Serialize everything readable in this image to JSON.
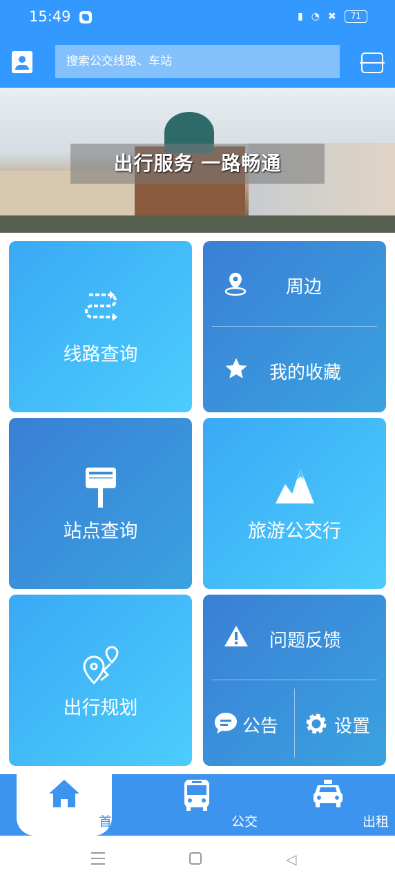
{
  "status_bar": {
    "time": "15:49",
    "battery": "71"
  },
  "header": {
    "search_placeholder": "搜索公交线路、车站"
  },
  "banner": {
    "caption": "出行服务 一路畅通"
  },
  "tiles": {
    "route_query": "线路查询",
    "nearby": "周边",
    "favorites": "我的收藏",
    "station_query": "站点查询",
    "tourism_bus": "旅游公交行",
    "trip_planning": "出行规划",
    "feedback": "问题反馈",
    "notice": "公告",
    "settings": "设置"
  },
  "colors": {
    "primary": "#3399ff",
    "nav": "#3d94ee",
    "tile_light": "#45bdf9",
    "tile_dark": "#3a8fdb"
  },
  "bottom_nav": [
    {
      "label": "首页",
      "icon": "home-icon",
      "active": true
    },
    {
      "label": "公交",
      "icon": "bus-icon"
    },
    {
      "label": "出租",
      "icon": "taxi-icon"
    }
  ]
}
